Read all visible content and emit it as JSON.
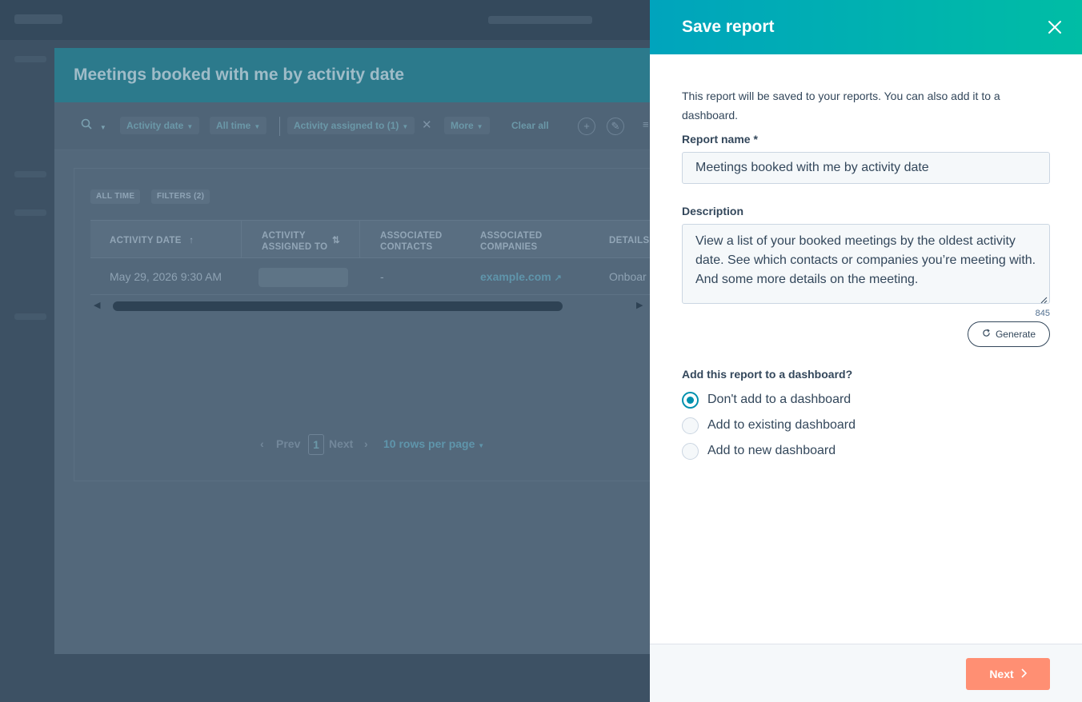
{
  "background": {
    "report_title": "Meetings booked with me by activity date",
    "filters": {
      "activity_date": "Activity date",
      "all_time": "All time",
      "assigned_to": "Activity assigned to (1)",
      "more": "More",
      "clear_all": "Clear all"
    },
    "tags": [
      "ALL TIME",
      "FILTERS (2)"
    ],
    "table": {
      "columns": [
        "ACTIVITY DATE",
        "ACTIVITY ASSIGNED TO",
        "ASSOCIATED CONTACTS",
        "ASSOCIATED COMPANIES",
        "DETAILS"
      ],
      "rows": [
        {
          "activity_date": "May 29, 2026 9:30 AM",
          "assigned_to": "",
          "contacts": "-",
          "companies": "example.com",
          "details": "Onboar"
        }
      ]
    },
    "pagination": {
      "prev": "Prev",
      "page": "1",
      "next": "Next",
      "rows_per_page": "10 rows per page"
    }
  },
  "panel": {
    "title": "Save report",
    "intro": "This report will be saved to your reports. You can also add it to a dashboard.",
    "report_name_label": "Report name *",
    "report_name_value": "Meetings booked with me by activity date",
    "description_label": "Description",
    "description_value": "View a list of your booked meetings by the oldest activity date. See which contacts or companies you’re meeting with. And some more details on the meeting.",
    "char_count": "845",
    "generate_label": "Generate",
    "dashboard_question": "Add this report to a dashboard?",
    "dashboard_options": [
      {
        "label": "Don't add to a dashboard",
        "selected": true
      },
      {
        "label": "Add to existing dashboard",
        "selected": false
      },
      {
        "label": "Add to new dashboard",
        "selected": false
      }
    ],
    "next_label": "Next"
  },
  "colors": {
    "header_gradient_start": "#00a4bd",
    "header_gradient_end": "#00bda5",
    "primary_button": "#ff8f73",
    "radio_accent": "#0091ae",
    "text": "#33475b"
  }
}
